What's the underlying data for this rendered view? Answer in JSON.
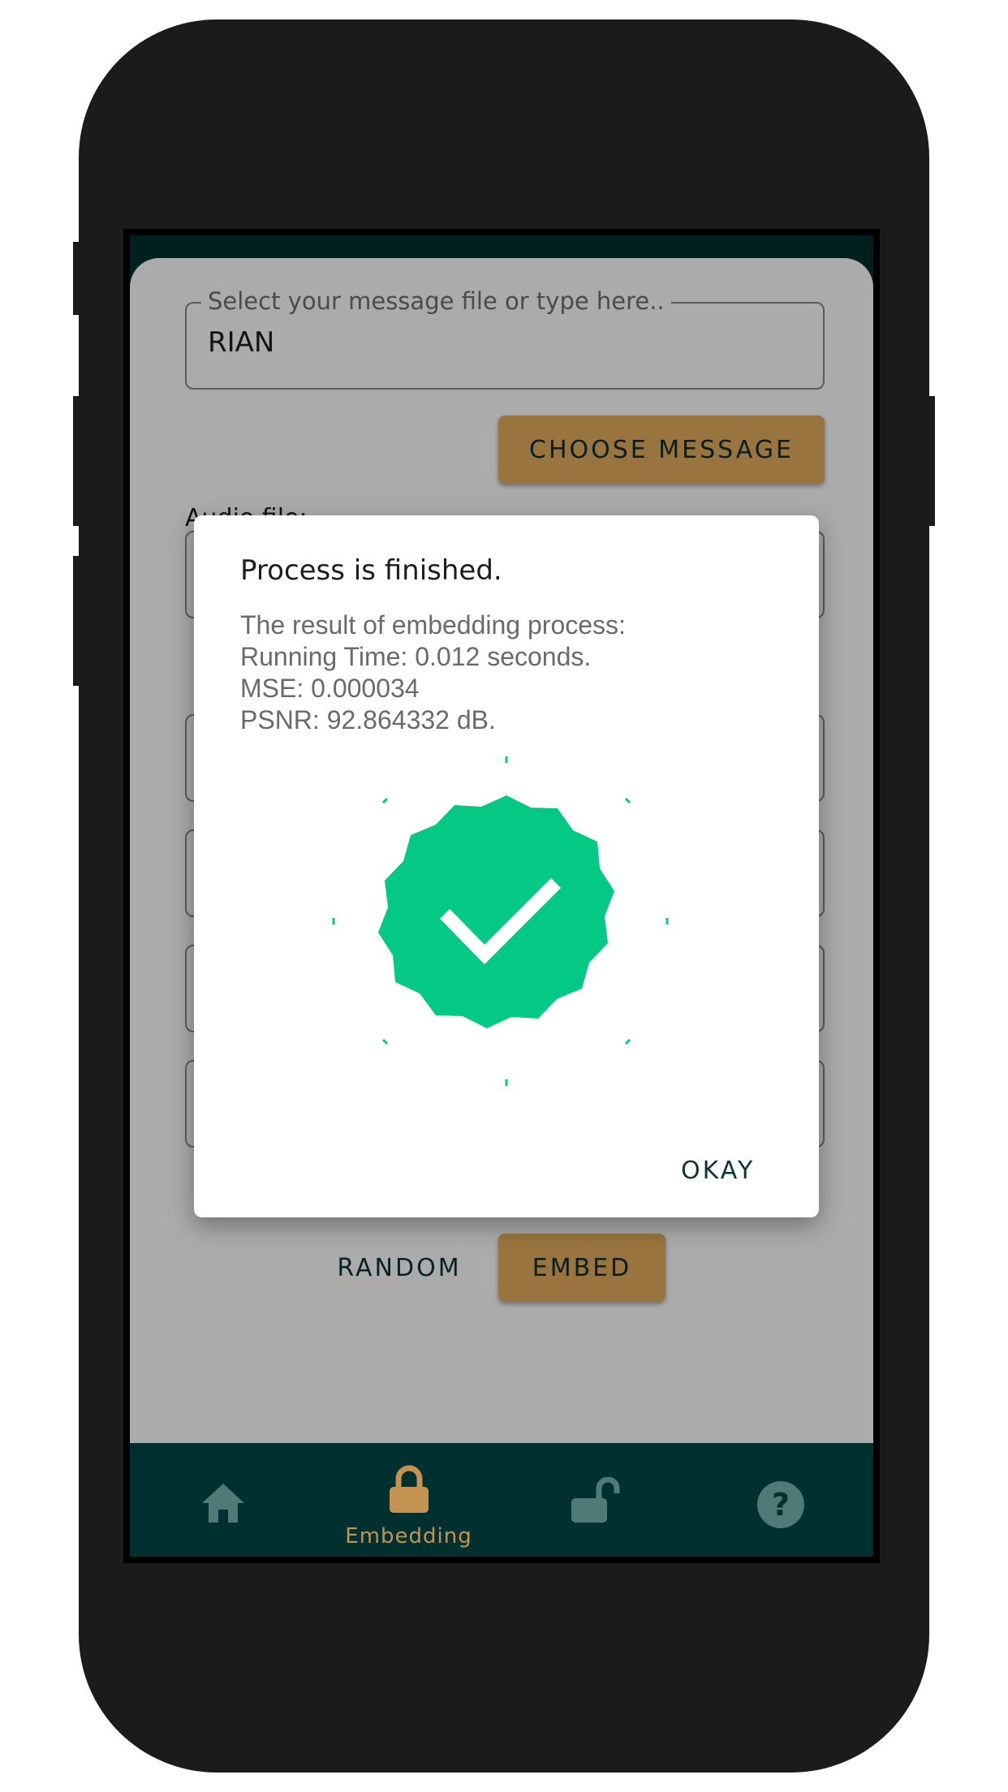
{
  "form": {
    "message_field": {
      "label": "Select your message file or type here..",
      "value": "RIAN"
    },
    "choose_message_label": "CHOOSE MESSAGE",
    "audio_file_label": "Audio file:",
    "random_label": "RANDOM",
    "embed_label": "EMBED"
  },
  "dialog": {
    "title": "Process is finished.",
    "lines": [
      "The result of embedding process:",
      "Running Time: 0.012 seconds.",
      "MSE: 0.000034",
      "PSNR: 92.864332 dB."
    ],
    "icon": "success-check-badge-icon",
    "ok_label": "OKAY"
  },
  "nav": {
    "items": [
      {
        "icon": "home-icon",
        "label": ""
      },
      {
        "icon": "lock-icon",
        "label": "Embedding",
        "active": true
      },
      {
        "icon": "unlock-icon",
        "label": ""
      },
      {
        "icon": "help-icon",
        "label": ""
      }
    ]
  },
  "colors": {
    "primary_dark": "#003030",
    "accent_gold": "#e5ae5d",
    "active_nav": "#c59351",
    "success_green": "#03c985",
    "device_frame": "#1b1b1b"
  }
}
